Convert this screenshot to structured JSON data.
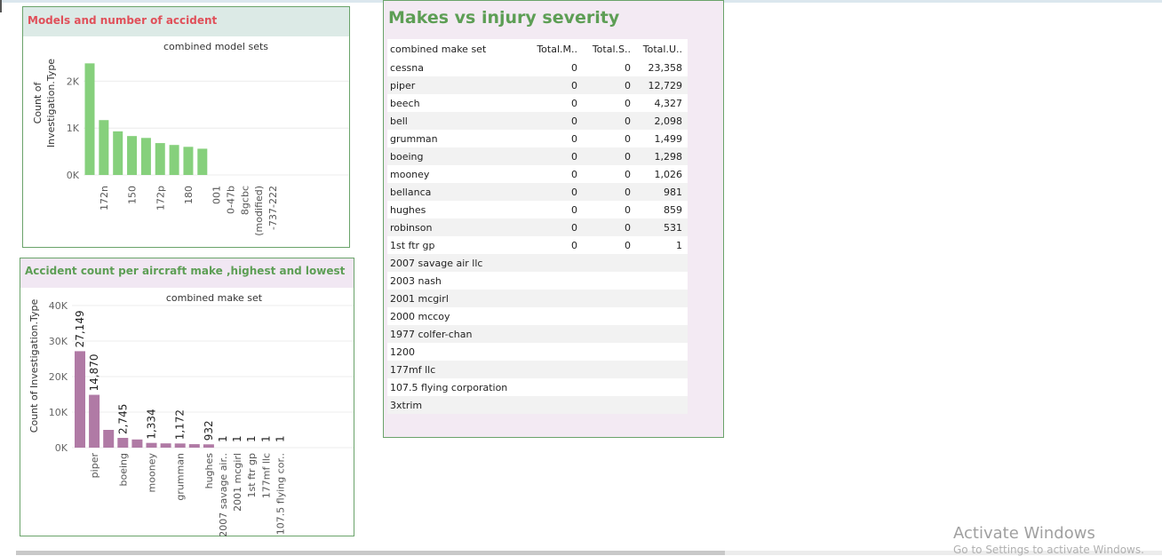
{
  "models_panel": {
    "title": "Models and number of accident",
    "header": "combined model sets",
    "chart_data": {
      "type": "bar",
      "ylabel": "Count of Investigation.Type",
      "xlabel": "",
      "ylim": [
        0,
        2500
      ],
      "yticks": [
        {
          "v": 0,
          "label": "0K"
        },
        {
          "v": 1000,
          "label": "1K"
        },
        {
          "v": 2000,
          "label": "2K"
        }
      ],
      "categories": [
        "",
        "172n",
        "",
        "150",
        "",
        "172p",
        "",
        "180",
        "",
        "001",
        "0-47b",
        "8gcbc",
        "(modified)",
        "-737-222"
      ],
      "values": [
        2380,
        1170,
        930,
        830,
        790,
        680,
        640,
        600,
        560,
        0,
        0,
        0,
        0,
        0
      ],
      "color": "#86d07c"
    }
  },
  "makes_panel": {
    "title": "Accident count per aircraft make ,highest and lowest",
    "header": "combined make set",
    "chart_data": {
      "type": "bar",
      "ylabel": "Count of Investigation.Type",
      "xlabel": "",
      "ylim": [
        0,
        40000
      ],
      "yticks": [
        {
          "v": 0,
          "label": "0K"
        },
        {
          "v": 10000,
          "label": "10K"
        },
        {
          "v": 20000,
          "label": "20K"
        },
        {
          "v": 30000,
          "label": "30K"
        },
        {
          "v": 40000,
          "label": "40K"
        }
      ],
      "categories": [
        "",
        "piper",
        "",
        "boeing",
        "",
        "mooney",
        "",
        "grumman",
        "",
        "hughes",
        "2007 savage air..",
        "2001 mcgirl",
        "1st ftr gp",
        "177mf llc",
        "107.5 flying cor.."
      ],
      "values": [
        27149,
        14870,
        5000,
        2745,
        2300,
        1334,
        1200,
        1172,
        980,
        932,
        1,
        1,
        1,
        1,
        1
      ],
      "data_labels": [
        "27,149",
        "14,870",
        "",
        "2,745",
        "",
        "1,334",
        "",
        "1,172",
        "",
        "932",
        "1",
        "1",
        "1",
        "1",
        "1"
      ],
      "color": "#b07aa5"
    }
  },
  "severity_panel": {
    "title": "Makes vs injury severity",
    "columns": [
      "combined make set",
      "Total.M..",
      "Total.S..",
      "Total.U.."
    ],
    "rows": [
      [
        "cessna",
        "0",
        "0",
        "23,358"
      ],
      [
        "piper",
        "0",
        "0",
        "12,729"
      ],
      [
        "beech",
        "0",
        "0",
        "4,327"
      ],
      [
        "bell",
        "0",
        "0",
        "2,098"
      ],
      [
        "grumman",
        "0",
        "0",
        "1,499"
      ],
      [
        "boeing",
        "0",
        "0",
        "1,298"
      ],
      [
        "mooney",
        "0",
        "0",
        "1,026"
      ],
      [
        "bellanca",
        "0",
        "0",
        "981"
      ],
      [
        "hughes",
        "0",
        "0",
        "859"
      ],
      [
        "robinson",
        "0",
        "0",
        "531"
      ],
      [
        "1st ftr gp",
        "0",
        "0",
        "1"
      ],
      [
        "2007 savage air llc",
        "",
        "",
        ""
      ],
      [
        "2003 nash",
        "",
        "",
        ""
      ],
      [
        "2001 mcgirl",
        "",
        "",
        ""
      ],
      [
        "2000 mccoy",
        "",
        "",
        ""
      ],
      [
        "1977 colfer-chan",
        "",
        "",
        ""
      ],
      [
        "1200",
        "",
        "",
        ""
      ],
      [
        "177mf llc",
        "",
        "",
        ""
      ],
      [
        "107.5 flying corporation",
        "",
        "",
        ""
      ],
      [
        "3xtrim",
        "",
        "",
        ""
      ]
    ]
  },
  "watermark": {
    "line1": "Activate Windows",
    "line2": "Go to Settings to activate Windows."
  }
}
